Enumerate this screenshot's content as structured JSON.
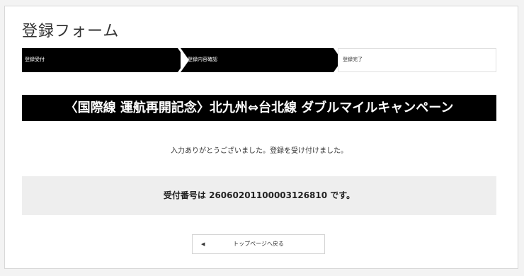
{
  "form": {
    "title": "登録フォーム"
  },
  "steps": [
    {
      "label": "登録受付",
      "state": "done"
    },
    {
      "label": "登録内容確認",
      "state": "done"
    },
    {
      "label": "登録完了",
      "state": "current"
    }
  ],
  "campaign": {
    "title": "〈国際線 運航再開記念〉北九州⇔台北線 ダブルマイルキャンペーン"
  },
  "message": {
    "thanks": "入力ありがとうございました。登録を受け付けました。"
  },
  "receipt": {
    "text": "受付番号は 26060201100003126810 です。"
  },
  "navigation": {
    "back_label": "トップページへ戻る",
    "back_icon": "triangle-left-icon"
  },
  "colors": {
    "banner_bg": "#000000",
    "banner_text": "#ffffff",
    "receipt_bg": "#eeeeee"
  }
}
